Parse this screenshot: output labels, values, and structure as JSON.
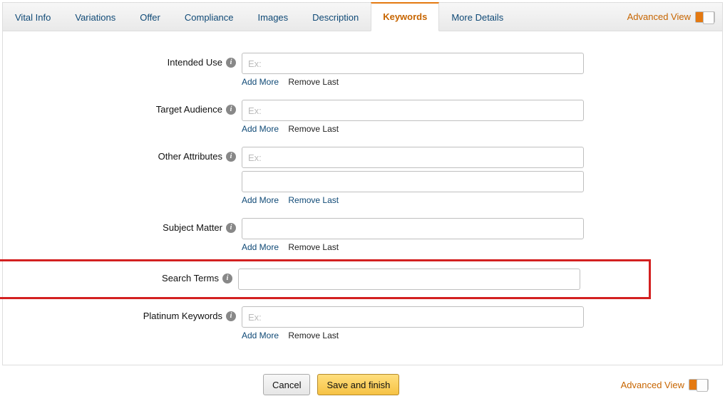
{
  "tabs": {
    "vital_info": "Vital Info",
    "variations": "Variations",
    "offer": "Offer",
    "compliance": "Compliance",
    "images": "Images",
    "description": "Description",
    "keywords": "Keywords",
    "more_details": "More Details"
  },
  "advanced_view": "Advanced View",
  "fields": {
    "intended_use": {
      "label": "Intended Use",
      "placeholder": "Ex:"
    },
    "target_audience": {
      "label": "Target Audience",
      "placeholder": "Ex:"
    },
    "other_attributes": {
      "label": "Other Attributes",
      "placeholder": "Ex:"
    },
    "subject_matter": {
      "label": "Subject Matter",
      "placeholder": ""
    },
    "search_terms": {
      "label": "Search Terms",
      "placeholder": ""
    },
    "platinum_keywords": {
      "label": "Platinum Keywords",
      "placeholder": "Ex:"
    }
  },
  "links": {
    "add_more": "Add More",
    "remove_last": "Remove Last"
  },
  "buttons": {
    "cancel": "Cancel",
    "save_finish": "Save and finish"
  },
  "info_char": "i"
}
